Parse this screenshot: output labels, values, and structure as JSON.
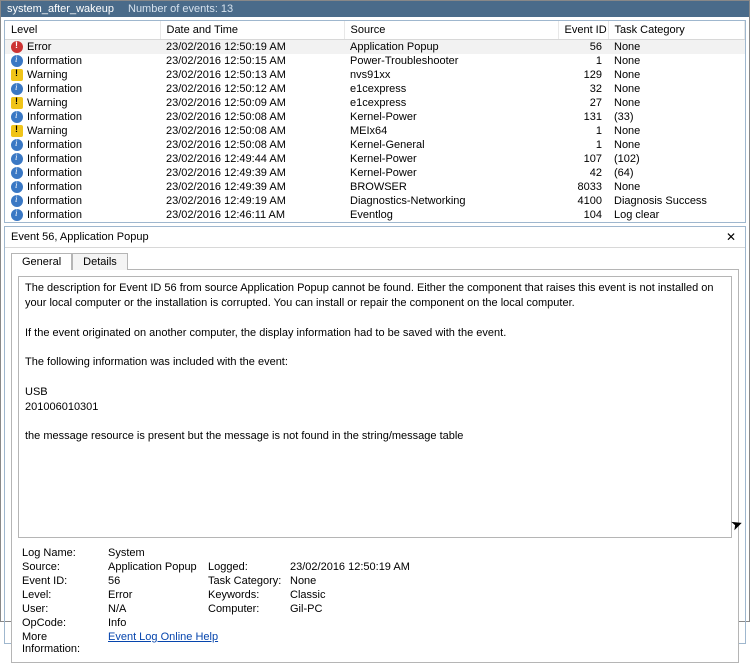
{
  "titlebar": {
    "filename": "system_after_wakeup",
    "count_label": "Number of events: 13"
  },
  "columns": {
    "level": "Level",
    "date": "Date and Time",
    "source": "Source",
    "eventid": "Event ID",
    "task": "Task Category"
  },
  "events": [
    {
      "level": "Error",
      "icon": "error",
      "date": "23/02/2016 12:50:19 AM",
      "source": "Application Popup",
      "id": "56",
      "task": "None"
    },
    {
      "level": "Information",
      "icon": "info",
      "date": "23/02/2016 12:50:15 AM",
      "source": "Power-Troubleshooter",
      "id": "1",
      "task": "None"
    },
    {
      "level": "Warning",
      "icon": "warn",
      "date": "23/02/2016 12:50:13 AM",
      "source": "nvs91xx",
      "id": "129",
      "task": "None"
    },
    {
      "level": "Information",
      "icon": "info",
      "date": "23/02/2016 12:50:12 AM",
      "source": "e1cexpress",
      "id": "32",
      "task": "None"
    },
    {
      "level": "Warning",
      "icon": "warn",
      "date": "23/02/2016 12:50:09 AM",
      "source": "e1cexpress",
      "id": "27",
      "task": "None"
    },
    {
      "level": "Information",
      "icon": "info",
      "date": "23/02/2016 12:50:08 AM",
      "source": "Kernel-Power",
      "id": "131",
      "task": "(33)"
    },
    {
      "level": "Warning",
      "icon": "warn",
      "date": "23/02/2016 12:50:08 AM",
      "source": "MEIx64",
      "id": "1",
      "task": "None"
    },
    {
      "level": "Information",
      "icon": "info",
      "date": "23/02/2016 12:50:08 AM",
      "source": "Kernel-General",
      "id": "1",
      "task": "None"
    },
    {
      "level": "Information",
      "icon": "info",
      "date": "23/02/2016 12:49:44 AM",
      "source": "Kernel-Power",
      "id": "107",
      "task": "(102)"
    },
    {
      "level": "Information",
      "icon": "info",
      "date": "23/02/2016 12:49:39 AM",
      "source": "Kernel-Power",
      "id": "42",
      "task": "(64)"
    },
    {
      "level": "Information",
      "icon": "info",
      "date": "23/02/2016 12:49:39 AM",
      "source": "BROWSER",
      "id": "8033",
      "task": "None"
    },
    {
      "level": "Information",
      "icon": "info",
      "date": "23/02/2016 12:49:19 AM",
      "source": "Diagnostics-Networking",
      "id": "4100",
      "task": "Diagnosis Success"
    },
    {
      "level": "Information",
      "icon": "info",
      "date": "23/02/2016 12:46:11 AM",
      "source": "Eventlog",
      "id": "104",
      "task": "Log clear"
    }
  ],
  "detail": {
    "title": "Event 56, Application Popup",
    "tabs": {
      "general": "General",
      "details": "Details"
    },
    "description": {
      "p1": "The description for Event ID 56 from source Application Popup cannot be found. Either the component that raises this event is not installed on your local computer or the installation is corrupted. You can install or repair the component on the local computer.",
      "p2": "If the event originated on another computer, the display information had to be saved with the event.",
      "p3": "The following information was included with the event:",
      "p4": "USB",
      "p5": "201006010301",
      "p6": "the message resource is present but the message is not found in the string/message table"
    },
    "props": {
      "log_name": {
        "label": "Log Name:",
        "value": "System"
      },
      "source": {
        "label": "Source:",
        "value": "Application Popup"
      },
      "logged": {
        "label": "Logged:",
        "value": "23/02/2016 12:50:19 AM"
      },
      "event_id": {
        "label": "Event ID:",
        "value": "56"
      },
      "task_cat": {
        "label": "Task Category:",
        "value": "None"
      },
      "level": {
        "label": "Level:",
        "value": "Error"
      },
      "keywords": {
        "label": "Keywords:",
        "value": "Classic"
      },
      "user": {
        "label": "User:",
        "value": "N/A"
      },
      "computer": {
        "label": "Computer:",
        "value": "Gil-PC"
      },
      "opcode": {
        "label": "OpCode:",
        "value": "Info"
      },
      "more_info": {
        "label": "More Information:",
        "link": "Event Log Online Help"
      }
    }
  }
}
